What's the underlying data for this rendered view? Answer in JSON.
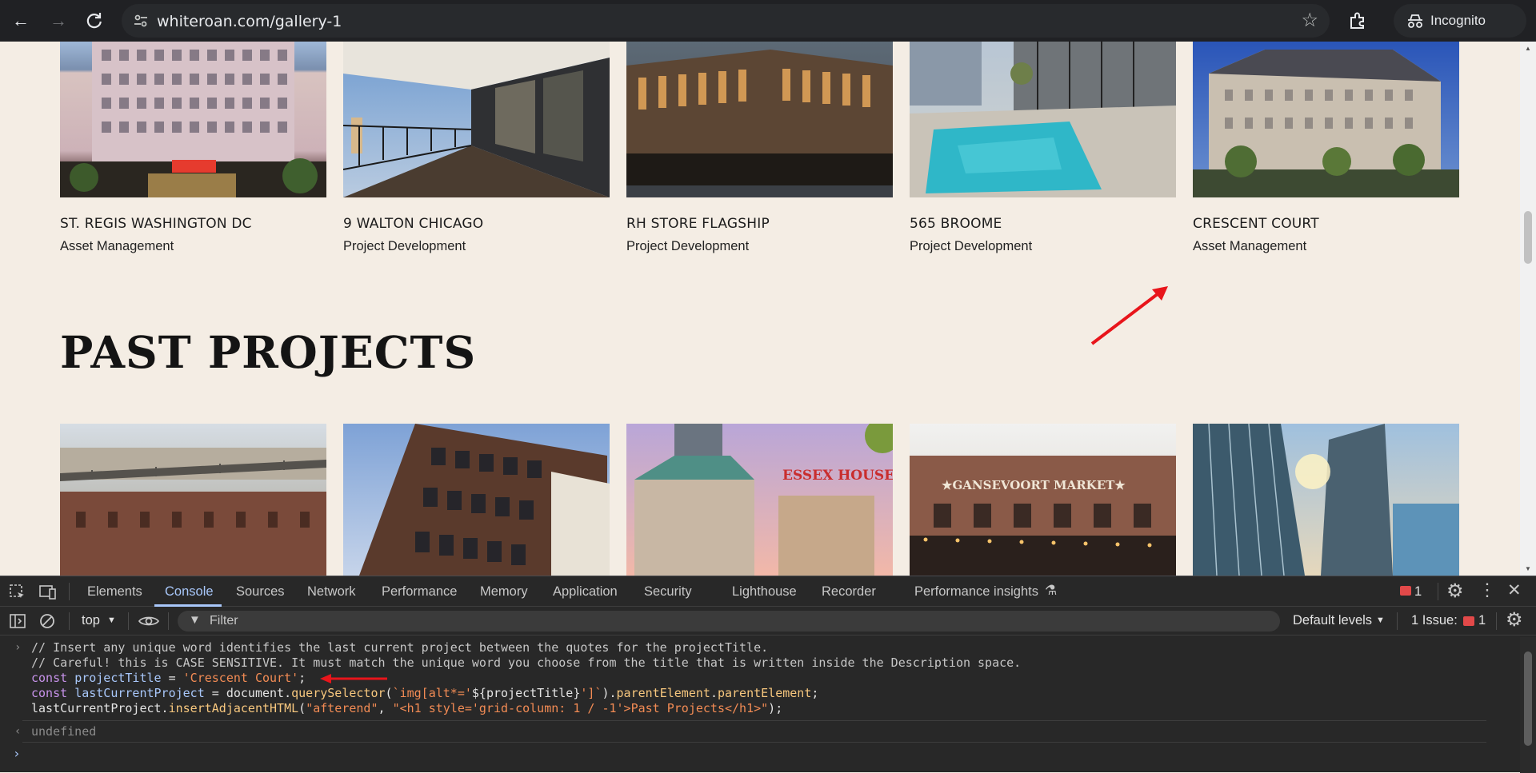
{
  "browser": {
    "url": "whiteroan.com/gallery-1",
    "profile_label": "Incognito"
  },
  "current_projects": [
    {
      "title": "ST. REGIS WASHINGTON DC",
      "category": "Asset Management"
    },
    {
      "title": "9 WALTON CHICAGO",
      "category": "Project Development"
    },
    {
      "title": "RH STORE FLAGSHIP",
      "category": "Project Development"
    },
    {
      "title": "565 BROOME",
      "category": "Project Development"
    },
    {
      "title": "CRESCENT COURT",
      "category": "Asset Management"
    }
  ],
  "past_projects_heading": "PAST PROJECTS",
  "past_project_sign_texts": [
    "ESSEX HOUSE",
    "★GANSEVOORT MARKET★"
  ],
  "devtools": {
    "tabs": [
      "Elements",
      "Console",
      "Sources",
      "Network",
      "Performance",
      "Memory",
      "Application",
      "Security",
      "Lighthouse",
      "Recorder",
      "Performance insights"
    ],
    "active_tab": "Console",
    "error_badge_count": "1",
    "context": "top",
    "filter_placeholder": "Filter",
    "levels": "Default levels",
    "issues_label": "1 Issue:",
    "issues_count": "1",
    "console": {
      "comment1": "// Insert any unique word identifies the last current project between the quotes for the projectTitle.",
      "comment2": "// Careful! this is CASE SENSITIVE. It must match the unique word you choose from the title that is written inside the Description space.",
      "line3": {
        "kw": "const",
        "var": "projectTitle",
        "op": " = ",
        "str": "'Crescent Court'",
        "end": ";"
      },
      "line4": {
        "kw": "const",
        "var": "lastCurrentProject",
        "op": " = document.",
        "fn1": "querySelector",
        "p1": "(",
        "tpl1": "`img[alt*='",
        "tplvar": "${projectTitle}",
        "tpl2": "']`",
        "p2": ").",
        "prop1": "parentElement",
        "dot": ".",
        "prop2": "parentElement",
        "end": ";"
      },
      "line5": {
        "obj": "lastCurrentProject.",
        "fn": "insertAdjacentHTML",
        "p1": "(",
        "s1": "\"afterend\"",
        "comma": ", ",
        "s2": "\"<h1 style='grid-column: 1 / -1'>Past Projects</h1>\"",
        "end": ");"
      },
      "result": "undefined"
    }
  },
  "colors": {
    "page_bg": "#f4ede4",
    "annotation_arrow": "#e8151b",
    "devtools_bg": "#282828",
    "active_tab": "#a8c7fa"
  }
}
